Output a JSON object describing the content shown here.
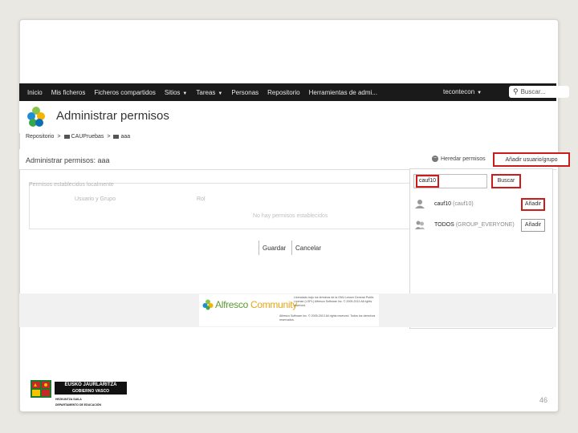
{
  "nav": {
    "items": [
      "Inicio",
      "Mis ficheros",
      "Ficheros compartidos",
      "Sitios",
      "Tareas",
      "Personas",
      "Repositorio",
      "Herramientas de admi..."
    ],
    "user": "tecontecon",
    "search_placeholder": "Buscar..."
  },
  "header": {
    "title": "Administrar permisos"
  },
  "breadcrumb": {
    "root": "Repositorio",
    "level1": "CAUPruebas",
    "level2": "aaa",
    "separator": ">"
  },
  "permissions": {
    "title": "Administrar permisos: aaa",
    "inherit_label": "Heredar permisos",
    "add_user_label": "Añadir usuario/grupo",
    "locally_set_label": "Permisos establecidos localmente",
    "col_user": "Usuario y Grupo",
    "col_role": "Rol",
    "empty_text": "No hay permisos establecidos",
    "save_label": "Guardar",
    "cancel_label": "Cancelar"
  },
  "picker": {
    "search_value": "cauf10",
    "find_label": "Buscar",
    "results": [
      {
        "name": "cauf10",
        "sub": "(cauf10)",
        "add_label": "Añadir",
        "icon": "user-icon"
      },
      {
        "name": "TODOS",
        "sub": "(GROUP_EVERYONE)",
        "add_label": "Añadir",
        "icon": "group-icon"
      }
    ]
  },
  "footer": {
    "brand": "Alfresco",
    "brand2": "Community",
    "legal": "Licenciado bajo los términos de la GNU Lesser General Public License (LGPL) Alfresco Software Inc. © 2005-2013 All rights reserved.",
    "legal2": "Alfresco Software Inc. © 2005-2013 All rights reserved. Todos los derechos reservados."
  },
  "gov": {
    "line1": "EUSKO JAURLARITZA",
    "line2": "GOBIERNO VASCO",
    "line3": "HEZKUNTZA SAILA",
    "line4": "DEPARTAMENTO DE EDUCACIÓN"
  },
  "page_number": "46",
  "colors": {
    "highlight": "#cc1b1b",
    "nav_bg": "#1a1a1a",
    "brand_green": "#5a9a33",
    "brand_orange": "#e8a515"
  }
}
